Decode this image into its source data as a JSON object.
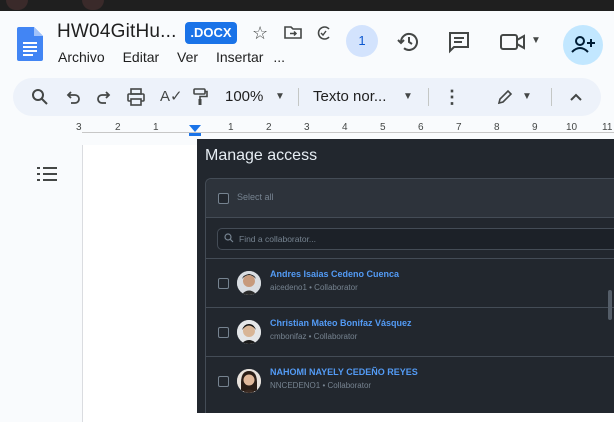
{
  "header": {
    "doc_title": "HW04GitHu...",
    "badge": ".DOCX",
    "menu": [
      "Archivo",
      "Editar",
      "Ver",
      "Insertar",
      "..."
    ],
    "active_users": "1"
  },
  "toolbar": {
    "zoom": "100%",
    "style": "Texto nor..."
  },
  "ruler": {
    "numbers": [
      "3",
      "2",
      "1",
      "1",
      "2",
      "3",
      "4",
      "5",
      "6",
      "7",
      "8",
      "9",
      "10",
      "11"
    ]
  },
  "panel": {
    "title": "Manage access",
    "select_all": "Select all",
    "search_placeholder": "Find a collaborator...",
    "collaborators": [
      {
        "name": "Andres Isaias Cedeno Cuenca",
        "meta": "aicedeno1 • Collaborator"
      },
      {
        "name": "Christian Mateo Bonifaz Vásquez",
        "meta": "cmbonifaz • Collaborator"
      },
      {
        "name": "NAHOMI NAYELY CEDEÑO REYES",
        "meta": "NNCEDENO1 • Collaborator"
      }
    ]
  },
  "colors": {
    "docs_blue": "#1a73e8",
    "panel_bg": "#22272e",
    "link_blue": "#539bf5",
    "share_bg": "#c2e7ff"
  },
  "icons": [
    "docs-logo-icon",
    "star-icon",
    "move-folder-icon",
    "cloud-status-icon",
    "history-icon",
    "comment-icon",
    "meet-icon",
    "share-icon",
    "search-icon",
    "undo-icon",
    "redo-icon",
    "print-icon",
    "spellcheck-icon",
    "paint-format-icon",
    "more-vert-icon",
    "edit-mode-icon",
    "chevron-up-icon",
    "outline-icon",
    "checkbox-icon",
    "magnifier-icon"
  ]
}
